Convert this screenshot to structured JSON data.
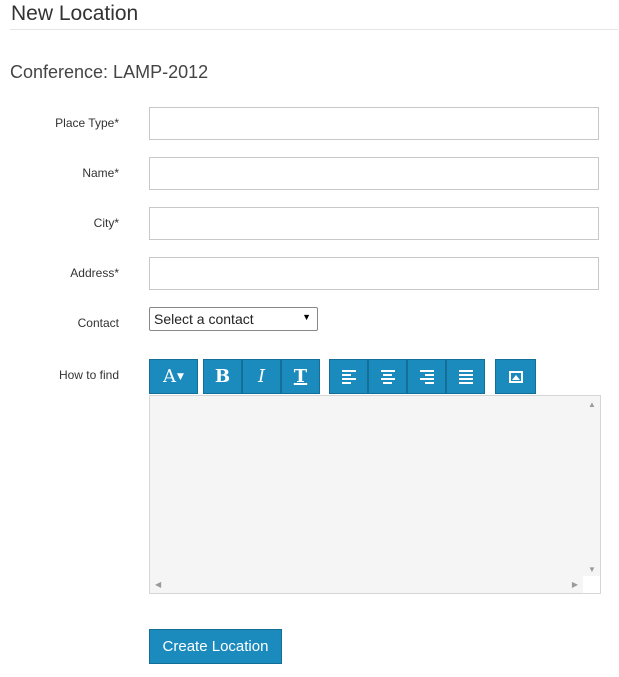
{
  "page": {
    "title": "New Location",
    "conference_title": "Conference: LAMP-2012"
  },
  "form": {
    "place_type": {
      "label": "Place Type*",
      "value": ""
    },
    "name": {
      "label": "Name*",
      "value": ""
    },
    "city": {
      "label": "City*",
      "value": ""
    },
    "address": {
      "label": "Address*",
      "value": ""
    },
    "contact": {
      "label": "Contact",
      "selected": "Select a contact"
    },
    "how_to_find": {
      "label": "How to find",
      "value": ""
    }
  },
  "toolbar": {
    "font_size": "A",
    "bold": "B",
    "italic": "I",
    "clear_format": "T"
  },
  "actions": {
    "submit_label": "Create Location"
  },
  "colors": {
    "accent": "#1b8bbd",
    "accent_border": "#136f97"
  }
}
